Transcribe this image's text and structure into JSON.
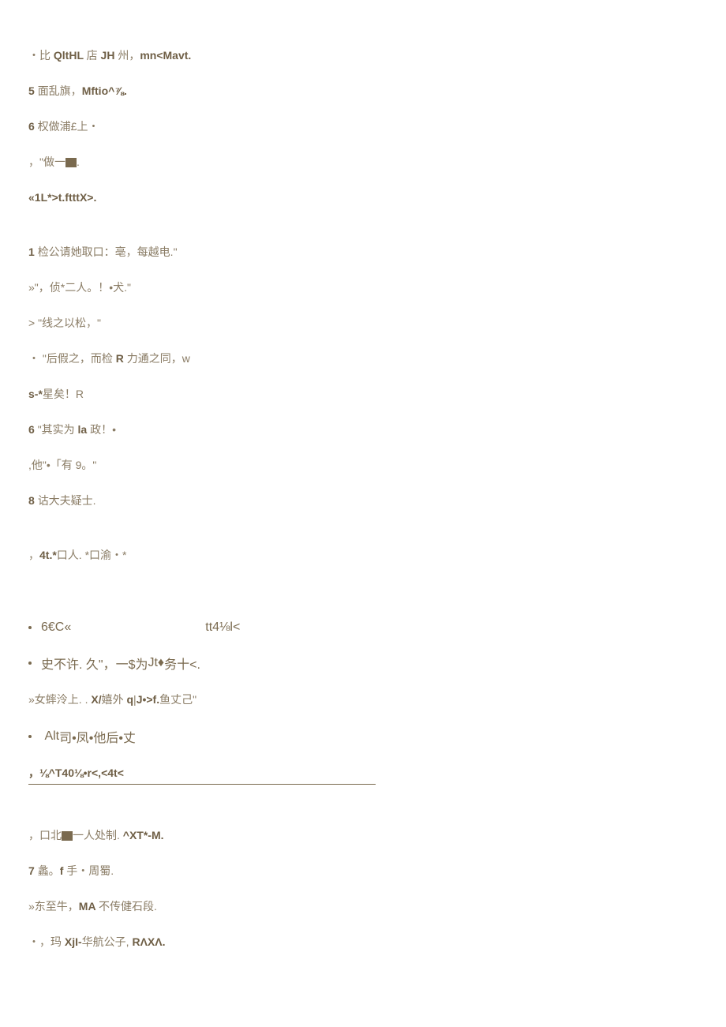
{
  "lines": {
    "l1a": "・比 ",
    "l1b": "QltHL ",
    "l1c": "店 ",
    "l1d": "JH ",
    "l1e": "州，",
    "l1f": "mn<Mavt.",
    "l2a": "5 ",
    "l2b": "面乱旗，",
    "l2c": "Mftio^⅞.",
    "l3a": "6 ",
    "l3b": "权做浦£上・",
    "l4a": "，\"做一",
    "l4b": ".",
    "l5a": "«1L*>t.ftttX>.",
    "l6a": "1 ",
    "l6b": "检公请她取口：亳，每越电.\"",
    "l7a": "»\"，侦*二人。！•犬.\"",
    "l8a": "> \"线之以松，\"",
    "l9a": "・ \"后假之，而检 ",
    "l9b": "R ",
    "l9c": "力通之同，",
    "l9d": "w",
    "l10a": "s-*",
    "l10b": "星矣！",
    "l10c": "R",
    "l11a": "6 ",
    "l11b": "\"其实为 ",
    "l11c": "la ",
    "l11d": "政！•",
    "l12a": ",他\"•「有 9。\"",
    "l13a": "8 ",
    "l13b": "诂大夫疑士.",
    "l14a": "，",
    "l14b": "4t.*",
    "l14c": "口人. *口渝・*",
    "b1a": "6€C«",
    "b1b": "tt4⅛l<",
    "b2a": "史不许. 久\"，一$为 ",
    "b2b": "Jt♦",
    "b2c": "务十<.",
    "l15a": "»女蟀泠上. . ",
    "l15b": "X/",
    "l15c": "嬉外 ",
    "l15d": "q",
    "l15e": "|",
    "l15f": "J•>f.",
    "l15g": "鱼丈己\"",
    "b3a": "Alt ",
    "b3b": "司•凤•他后•丈",
    "u1a": "，⅛^T40⅛•r<,<4t<",
    "l16a": "，口北",
    "l16b": "一人处制. ",
    "l16c": "^XT*-M.",
    "l17a": "7 ",
    "l17b": "蠡。",
    "l17c": "f ",
    "l17d": "手・周蜀.",
    "l18a": "»东至牛，",
    "l18b": "MA ",
    "l18c": "不传健石段.",
    "l19a": "・，玛 ",
    "l19b": "XjI-",
    "l19c": "华航公子, ",
    "l19d": "RΛXΛ."
  }
}
